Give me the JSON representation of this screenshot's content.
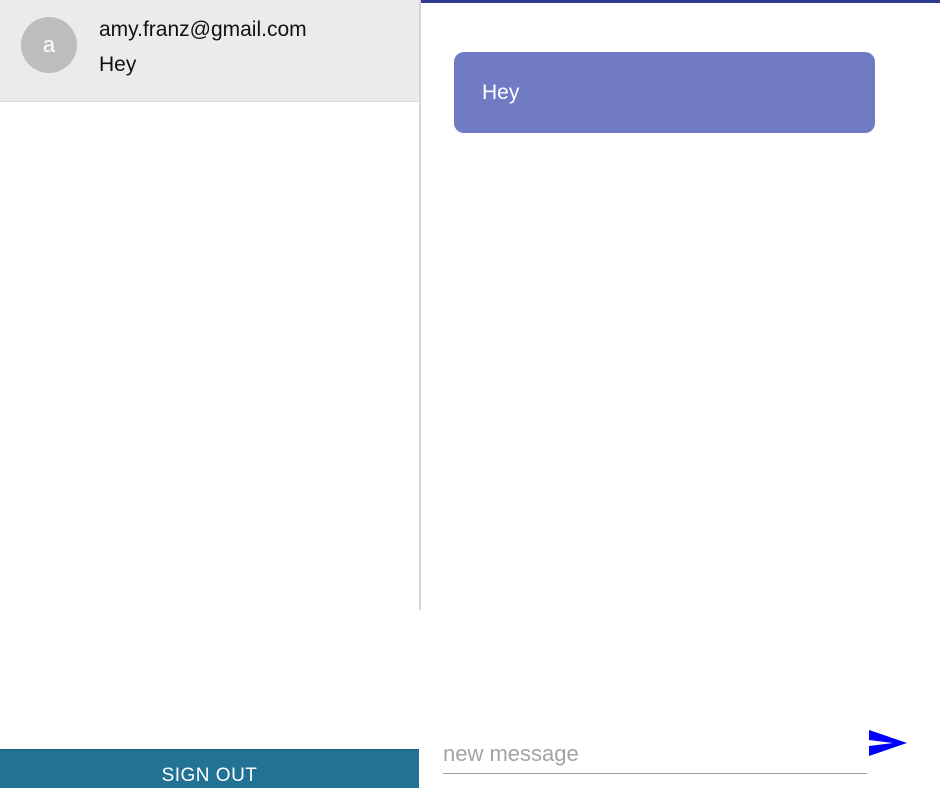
{
  "sidebar": {
    "chats": [
      {
        "avatar_letter": "a",
        "email": "amy.franz@gmail.com",
        "last_message": "Hey"
      }
    ],
    "signout_label": "SIGN OUT"
  },
  "conversation": {
    "messages": [
      {
        "text": "Hey"
      }
    ],
    "composer": {
      "placeholder": "new message",
      "send_icon": "send-icon"
    }
  },
  "colors": {
    "accent_bar": "#2f3b8f",
    "bubble": "#717bc4",
    "signout": "#227296",
    "send_icon": "#0000ff",
    "selected_chat": "#ebebeb"
  }
}
